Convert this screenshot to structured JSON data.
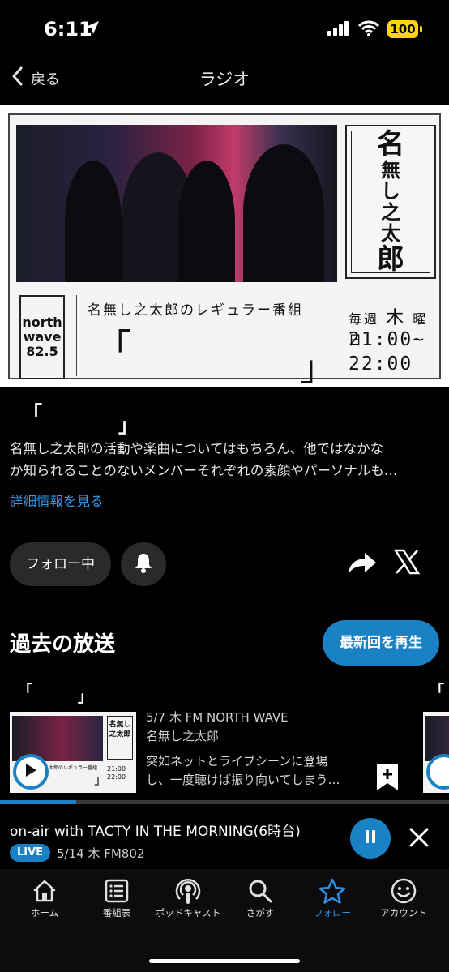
{
  "status_bar": {
    "time": "6:11",
    "battery": "100"
  },
  "nav": {
    "back_label": "戻る",
    "title": "ラジオ"
  },
  "banner": {
    "logo_chars": [
      "名",
      "無",
      "し",
      "之",
      "太",
      "郎"
    ],
    "fm_logo_lines": [
      "north",
      "wave",
      "82.5"
    ],
    "subtitle": "名無し之太郎のレギュラー番組",
    "bracket_open": "「",
    "bracket_close": "」",
    "schedule_prefix": "毎週",
    "schedule_day": "木",
    "schedule_suffix": "曜日",
    "time_start": "21:00~",
    "time_end": "22:00"
  },
  "program": {
    "title_open": "「",
    "title_close": "」",
    "description_line1": "名無し之太郎の活動や楽曲についてはもちろん、他ではなかな",
    "description_line2": "か知られることのないメンバーそれぞれの素顔やパーソナルも…",
    "more_link": "詳細情報を見る"
  },
  "actions": {
    "follow_label": "フォロー中"
  },
  "past": {
    "section_title": "過去の放送",
    "latest_button": "最新回を再生",
    "episode": {
      "title_open": "「",
      "title_close": "」",
      "meta": "5/7 木 FM NORTH WAVE",
      "artist": "名無し之太郎",
      "desc_line1": "突如ネットとライブシーンに登場",
      "desc_line2": "し、一度聴けば振り向いてしまう…",
      "thumb_sub": "太郎のレギュラー番組",
      "thumb_time": "21:00~\n22:00",
      "thumb_logo": "名無し之太郎"
    },
    "next_title_open": "「"
  },
  "now_playing": {
    "title": "on-air with TACTY IN THE MORNING(6時台)",
    "live_label": "LIVE",
    "meta": "5/14 木 FM802",
    "progress_percent": 17
  },
  "tabs": [
    {
      "label": "ホーム",
      "icon": "home-icon"
    },
    {
      "label": "番組表",
      "icon": "list-icon"
    },
    {
      "label": "ポッドキャスト",
      "icon": "podcast-icon"
    },
    {
      "label": "さがす",
      "icon": "search-icon"
    },
    {
      "label": "フォロー",
      "icon": "star-icon",
      "active": true
    },
    {
      "label": "アカウント",
      "icon": "smiley-icon"
    }
  ],
  "colors": {
    "accent": "#1a82c4",
    "link": "#2f9be8",
    "battery": "#ffd60a"
  }
}
